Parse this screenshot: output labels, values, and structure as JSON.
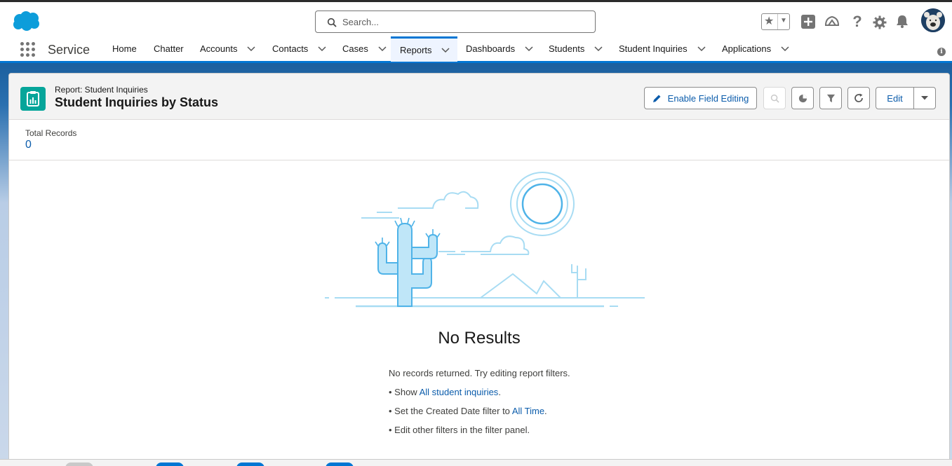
{
  "search": {
    "placeholder": "Search..."
  },
  "app_name": "Service",
  "nav": [
    {
      "label": "Home",
      "dropdown": false
    },
    {
      "label": "Chatter",
      "dropdown": false
    },
    {
      "label": "Accounts",
      "dropdown": true
    },
    {
      "label": "Contacts",
      "dropdown": true
    },
    {
      "label": "Cases",
      "dropdown": true
    },
    {
      "label": "Reports",
      "dropdown": true,
      "active": true
    },
    {
      "label": "Dashboards",
      "dropdown": true
    },
    {
      "label": "Students",
      "dropdown": true
    },
    {
      "label": "Student Inquiries",
      "dropdown": true
    },
    {
      "label": "Applications",
      "dropdown": true
    }
  ],
  "header_icons": [
    "favorites-star-icon",
    "add-icon",
    "trailhead-icon",
    "help-icon",
    "setup-gear-icon",
    "notifications-bell-icon",
    "user-avatar"
  ],
  "report": {
    "object_label": "Report: Student Inquiries",
    "title": "Student Inquiries by Status",
    "enable_field_editing": "Enable Field Editing",
    "edit": "Edit"
  },
  "toolbar_icons": [
    "search-icon",
    "chart-icon",
    "filter-icon",
    "refresh-icon",
    "chevron-down-icon"
  ],
  "total_records": {
    "label": "Total Records",
    "value": "0"
  },
  "empty": {
    "heading": "No Results",
    "line1": "No records returned. Try editing report filters.",
    "line2_prefix": "• Show ",
    "line2_link": "All student inquiries",
    "line2_suffix": ".",
    "line3_prefix": "• Set the Created Date filter to ",
    "line3_link": "All Time",
    "line3_suffix": ".",
    "line4": "• Edit other filters in the filter panel."
  },
  "colors": {
    "brand": "#0176d3",
    "link": "#0b5cab",
    "report_icon": "#06a59a",
    "illustration": "#a8dcf3"
  }
}
